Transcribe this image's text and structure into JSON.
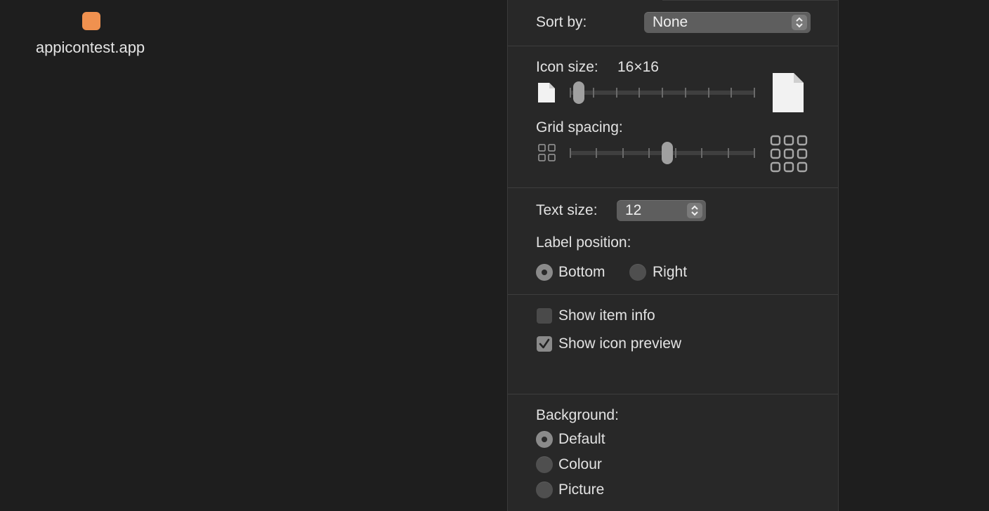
{
  "desktop": {
    "file_label": "appicontest.app",
    "file_icon_color": "#f0914f"
  },
  "panel": {
    "sort_by": {
      "label": "Sort by:",
      "value": "None"
    },
    "icon_size": {
      "label": "Icon size:",
      "value": "16×16",
      "slider_fraction": 0.02
    },
    "grid_spacing": {
      "label": "Grid spacing:",
      "slider_fraction": 0.53
    },
    "text_size": {
      "label": "Text size:",
      "value": "12"
    },
    "label_position": {
      "label": "Label position:",
      "bottom": "Bottom",
      "right": "Right",
      "selected": "Bottom"
    },
    "show_item_info": {
      "label": "Show item info",
      "checked": false
    },
    "show_icon_preview": {
      "label": "Show icon preview",
      "checked": true
    },
    "background": {
      "label": "Background:",
      "options": [
        "Default",
        "Colour",
        "Picture"
      ],
      "selected": "Default"
    }
  },
  "icons": [
    "document-small-icon",
    "document-large-icon",
    "grid-small-icon",
    "grid-large-icon",
    "stepper-arrows-icon",
    "checkmark-icon"
  ]
}
